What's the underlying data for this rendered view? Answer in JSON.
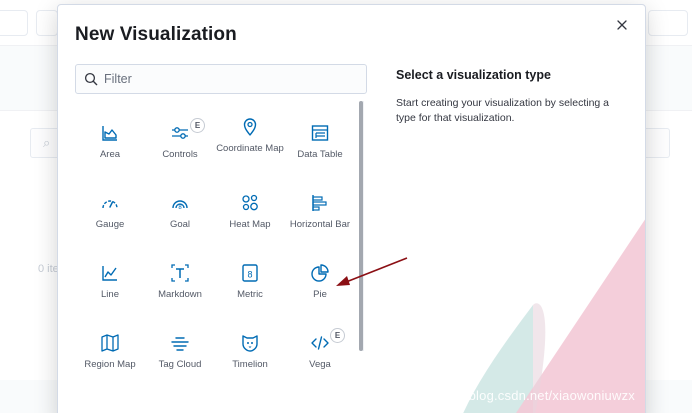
{
  "modal": {
    "title": "New Visualization",
    "filter": {
      "placeholder": "Filter",
      "value": ""
    },
    "side_title": "Select a visualization type",
    "side_description": "Start creating your visualization by selecting a type for that visualization."
  },
  "tiles": [
    {
      "label": "Area",
      "icon": "area-chart-icon"
    },
    {
      "label": "Controls",
      "icon": "controls-icon",
      "badge": "E"
    },
    {
      "label": "Coordinate Map",
      "icon": "map-marker-icon"
    },
    {
      "label": "Data Table",
      "icon": "data-table-icon"
    },
    {
      "label": "Gauge",
      "icon": "gauge-icon"
    },
    {
      "label": "Goal",
      "icon": "goal-icon"
    },
    {
      "label": "Heat Map",
      "icon": "heat-map-icon"
    },
    {
      "label": "Horizontal Bar",
      "icon": "horizontal-bar-icon"
    },
    {
      "label": "Line",
      "icon": "line-chart-icon"
    },
    {
      "label": "Markdown",
      "icon": "markdown-icon"
    },
    {
      "label": "Metric",
      "icon": "metric-icon"
    },
    {
      "label": "Pie",
      "icon": "pie-chart-icon"
    },
    {
      "label": "Region Map",
      "icon": "region-map-icon"
    },
    {
      "label": "Tag Cloud",
      "icon": "tag-cloud-icon"
    },
    {
      "label": "Timelion",
      "icon": "timelion-icon"
    },
    {
      "label": "Vega",
      "icon": "vega-icon",
      "badge": "E"
    }
  ],
  "background": {
    "items_fragment": "0 ite"
  },
  "watermark": "https://blog.csdn.net/xiaowoniuwzx",
  "colors": {
    "icon": "#006bb4",
    "arrow": "#8b0f14",
    "deco_pink": "#f3c9d6",
    "deco_teal": "#cfe7e4"
  }
}
